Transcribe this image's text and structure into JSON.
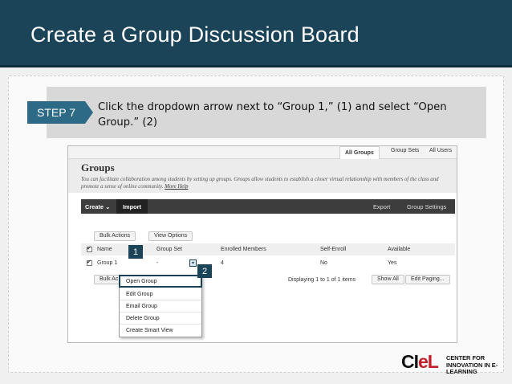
{
  "slide": {
    "title": "Create a Group Discussion Board",
    "step_label": "STEP 7",
    "instruction": "Click the dropdown arrow next to “Group 1,” (1) and select “Open Group.” (2)"
  },
  "screenshot": {
    "top_tabs": [
      "All Groups",
      "Group Sets",
      "All Users"
    ],
    "heading": "Groups",
    "description": "You can facilitate collaboration among students by setting up groups. Groups allow students to establish a closer virtual relationship with members of the class and promote a sense of online community.",
    "more_help": "More Help",
    "action_bar": {
      "create": "Create",
      "import": "Import",
      "export": "Export",
      "group_settings": "Group Settings"
    },
    "bulk_actions": "Bulk Actions",
    "view_options": "View Options",
    "columns": [
      "Name",
      "Group Set",
      "Enrolled Members",
      "Self-Enroll",
      "Available"
    ],
    "row": {
      "name": "Group 1",
      "group_set": "-",
      "enrolled": "4",
      "self_enroll": "No",
      "available": "Yes"
    },
    "bulk_actions_short": "Bulk Ac",
    "paging_text": "Displaying 1 to 1 of 1 items",
    "show_all": "Show All",
    "edit_paging": "Edit Paging...",
    "menu_items": [
      "Open Group",
      "Edit Group",
      "Email Group",
      "Delete Group",
      "Create Smart View"
    ],
    "markers": [
      "1",
      "2"
    ]
  },
  "logo": {
    "mark_ci": "CI",
    "mark_el": "eL",
    "text": "CENTER FOR INNOVATION IN E-LEARNING"
  },
  "colors": {
    "title_bar": "#1b4458",
    "step_badge": "#2d6a86",
    "marker": "#1b4458",
    "logo_red": "#c0202a"
  }
}
